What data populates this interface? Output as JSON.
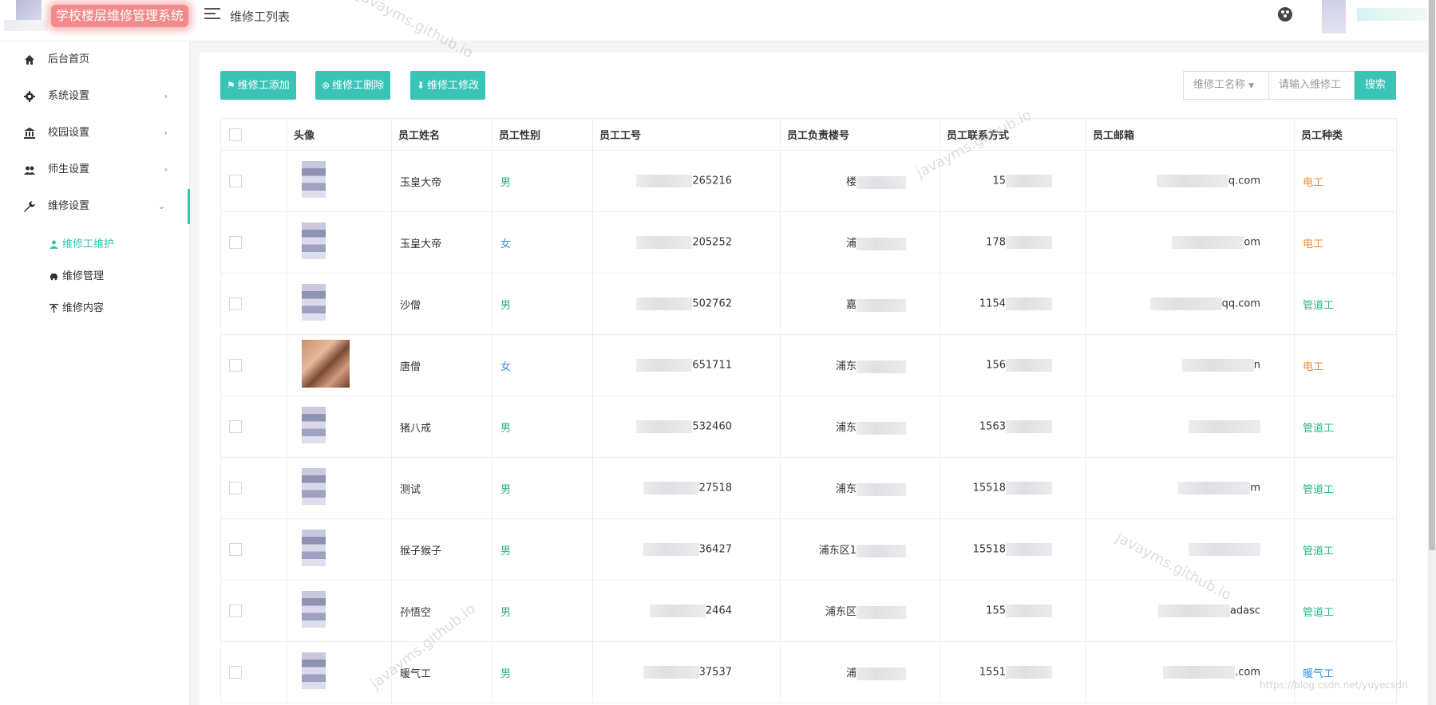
{
  "header": {
    "app_title": "学校楼层维修管理系统",
    "page_title": "维修工列表"
  },
  "sidebar": {
    "items": [
      {
        "label": "后台首页",
        "icon": "home-icon"
      },
      {
        "label": "系统设置",
        "icon": "gear-icon"
      },
      {
        "label": "校园设置",
        "icon": "bank-icon"
      },
      {
        "label": "师生设置",
        "icon": "people-icon"
      },
      {
        "label": "维修设置",
        "icon": "wrench-icon"
      }
    ],
    "sub_items": [
      {
        "label": "维修工维护",
        "icon": "user-icon",
        "active": true
      },
      {
        "label": "维修管理",
        "icon": "car-icon"
      },
      {
        "label": "维修内容",
        "icon": "pin-icon"
      }
    ]
  },
  "toolbar": {
    "add_label": "维修工添加",
    "delete_label": "维修工删除",
    "edit_label": "维修工修改",
    "search_field": "维修工名称",
    "search_placeholder": "请输入维修工",
    "search_label": "搜索"
  },
  "table": {
    "columns": [
      "头像",
      "员工姓名",
      "员工性别",
      "员工工号",
      "员工负责楼号",
      "员工联系方式",
      "员工邮箱",
      "员工种类"
    ],
    "rows": [
      {
        "name": "玉皇大帝",
        "gender": "男",
        "id": "265216",
        "building": "楼",
        "phone": "15",
        "email": "q.com",
        "type": "电工"
      },
      {
        "name": "玉皇大帝",
        "gender": "女",
        "id": "205252",
        "building": "浦",
        "phone": "178",
        "email": "om",
        "type": "电工"
      },
      {
        "name": "沙僧",
        "gender": "男",
        "id": "502762",
        "building": "嘉",
        "phone": "1154",
        "email": "qq.com",
        "type": "管道工"
      },
      {
        "name": "唐僧",
        "gender": "女",
        "id": "651711",
        "building": "浦东",
        "phone": "156",
        "email": "n",
        "type": "电工"
      },
      {
        "name": "猪八戒",
        "gender": "男",
        "id": "532460",
        "building": "浦东",
        "phone": "1563",
        "email": "",
        "type": "管道工"
      },
      {
        "name": "测试",
        "gender": "男",
        "id": "27518",
        "building": "浦东",
        "phone": "15518",
        "email": "m",
        "type": "管道工"
      },
      {
        "name": "猴子猴子",
        "gender": "男",
        "id": "36427",
        "building": "浦东区1",
        "phone": "15518",
        "email": "",
        "type": "管道工"
      },
      {
        "name": "孙悟空",
        "gender": "男",
        "id": "2464",
        "building": "浦东区",
        "phone": "155",
        "email": "adasc",
        "type": "管道工"
      },
      {
        "name": "暖气工",
        "gender": "男",
        "id": "37537",
        "building": "浦",
        "phone": "1551",
        "email": ".com",
        "type": "暖气工"
      }
    ]
  },
  "watermark": "javayms.github.io",
  "credit": "https://blog.csdn.net/yuyecsdn",
  "colors": {
    "accent": "#39c4b6",
    "logo_bg": "#f18a8a"
  }
}
